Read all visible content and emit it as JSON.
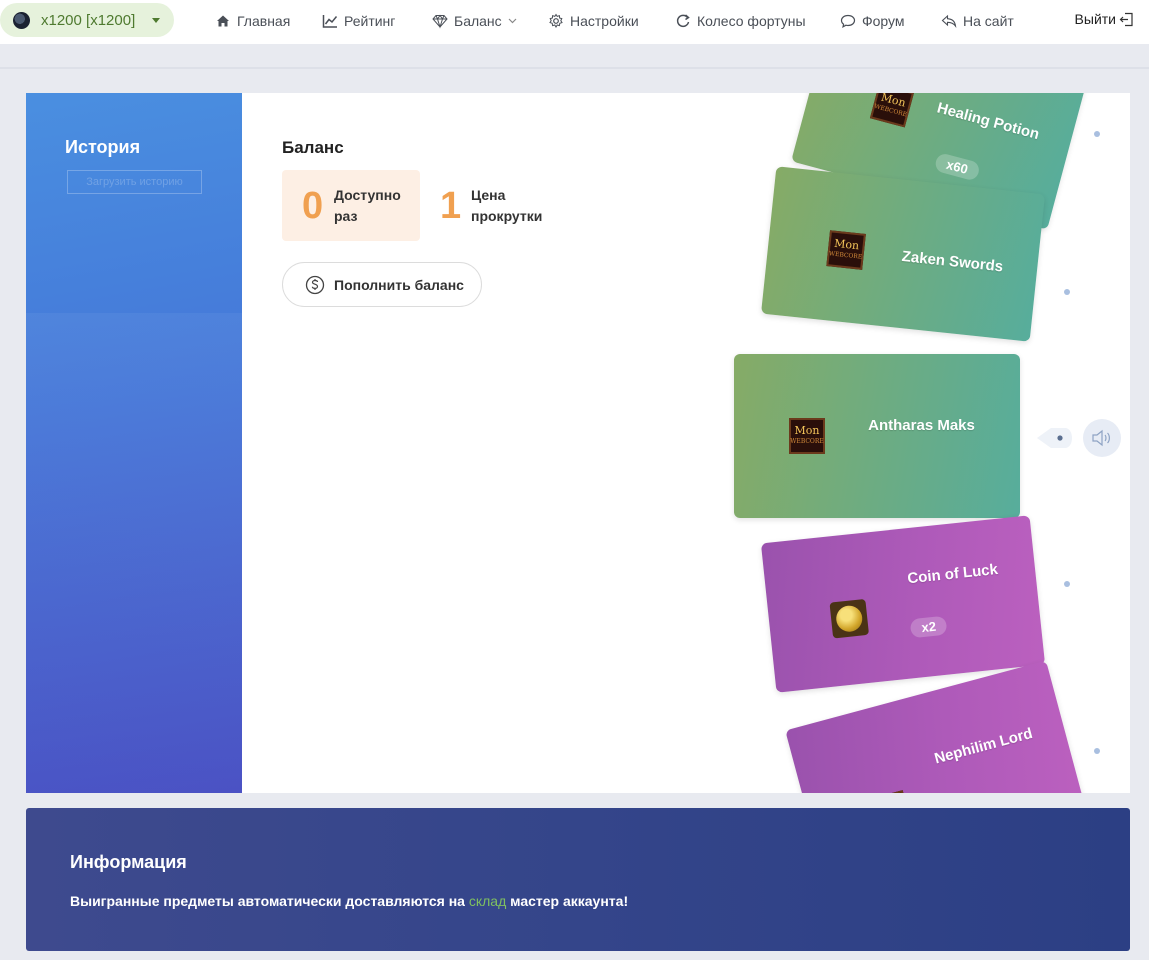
{
  "topnav": {
    "server": "x1200 [x1200]",
    "items": [
      {
        "label": "Главная",
        "icon": "home-icon"
      },
      {
        "label": "Рейтинг",
        "icon": "chart-line-icon"
      },
      {
        "label": "Баланс",
        "icon": "diamond-icon"
      },
      {
        "label": "Настройки",
        "icon": "gear-icon"
      },
      {
        "label": "Колесо фортуны",
        "icon": "refresh-icon"
      },
      {
        "label": "Форум",
        "icon": "chat-icon"
      },
      {
        "label": "На сайт",
        "icon": "reply-icon"
      }
    ],
    "logout": "Выйти"
  },
  "sidebar": {
    "title": "История",
    "button": "Загрузить историю"
  },
  "balance": {
    "title": "Баланс",
    "available_value": "0",
    "available_label": "Доступно раз",
    "price_value": "1",
    "price_label": "Цена прокрутки",
    "topup_label": "Пополнить баланс"
  },
  "wheel": {
    "cards": [
      {
        "name": "Healing Potion",
        "qty": "x60",
        "color": "green",
        "icon": "mon-icon"
      },
      {
        "name": "Zaken Swords",
        "qty": "",
        "color": "green",
        "icon": "mon-icon"
      },
      {
        "name": "Antharas Maks",
        "qty": "",
        "color": "green",
        "icon": "mon-icon"
      },
      {
        "name": "Coin of Luck",
        "qty": "x2",
        "color": "purple",
        "icon": "coin-icon"
      },
      {
        "name": "Nephilim Lord",
        "qty": "",
        "color": "purple",
        "icon": "mon-icon"
      }
    ],
    "mon_text": "Mon",
    "mon_sub": "WEBCORE"
  },
  "info": {
    "title": "Информация",
    "text_before": "Выигранные предметы автоматически доставляются на",
    "link": "склад",
    "text_after": "мастер аккаунта!"
  },
  "colors": {
    "accent_orange": "#f0a050",
    "server_green": "#4e7a2f",
    "info_bg": "#34458a",
    "card_green": "#6bac84",
    "card_purple": "#ae5ab9"
  }
}
